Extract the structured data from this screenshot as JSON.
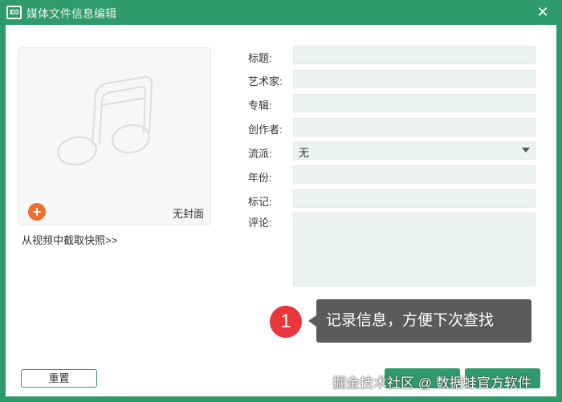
{
  "titlebar": {
    "logo_text": "ID3",
    "title": "媒体文件信息编辑",
    "close_glyph": "✕"
  },
  "cover": {
    "add_glyph": "+",
    "no_cover_label": "无封面",
    "snapshot_link": "从视频中截取快照>>"
  },
  "fields": {
    "title_label": "标题:",
    "title_value": "",
    "artist_label": "艺术家:",
    "artist_value": "",
    "album_label": "专辑:",
    "album_value": "",
    "composer_label": "创作者:",
    "composer_value": "",
    "genre_label": "流派:",
    "genre_value": "无",
    "year_label": "年份:",
    "year_value": "",
    "tag_label": "标记:",
    "tag_value": "",
    "comment_label": "评论:",
    "comment_value": ""
  },
  "buttons": {
    "reset_label": "重置"
  },
  "callout": {
    "number": "1",
    "text": "记录信息，方便下次查找"
  },
  "watermark": {
    "text": "掘金技术社区 @ 数据蛙官方软件"
  },
  "icons": {
    "cover_placeholder": "music-note-icon",
    "add": "plus-icon",
    "close": "close-icon",
    "dropdown": "chevron-down-icon"
  },
  "colors": {
    "brand_green": "#2f9a6c",
    "input_bg": "#ecf2ef",
    "add_orange": "#f26b2f",
    "callout_red": "#e9363a",
    "callout_gray": "#5b5b5b"
  }
}
